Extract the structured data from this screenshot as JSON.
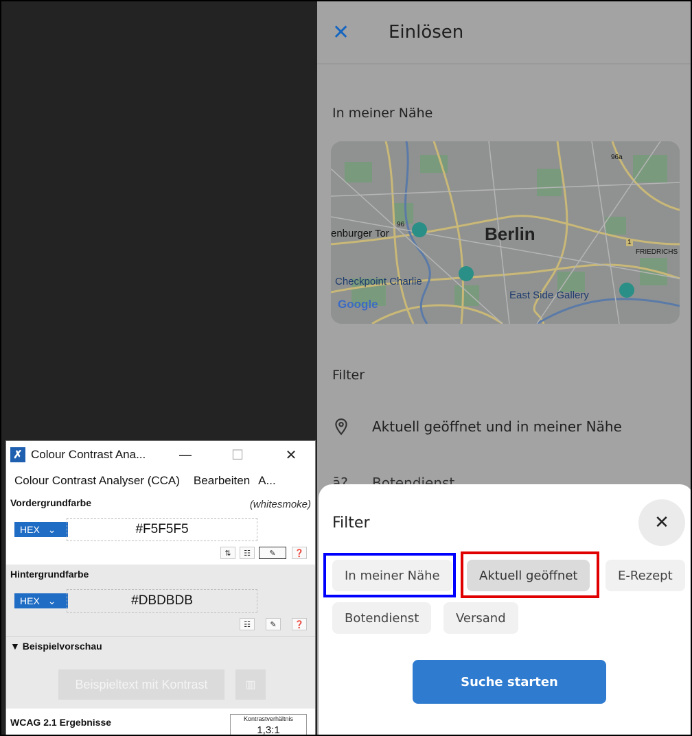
{
  "app": {
    "close_icon": "close-icon",
    "title": "Einlösen",
    "nearby_label": "In meiner Nähe",
    "map": {
      "city": "Berlin",
      "labels": [
        "enburger Tor",
        "Checkpoint Charlie",
        "East Side Gallery",
        "FRIEDRICHS",
        "96",
        "96a",
        "1"
      ],
      "attribution": "Google"
    },
    "filter_label": "Filter",
    "filter_row_text": "Aktuell geöffnet und in meiner Nähe",
    "partial_row_text": "Botendienst"
  },
  "sheet": {
    "title": "Filter",
    "close_icon": "close-icon",
    "chips": [
      "In meiner Nähe",
      "Aktuell geöffnet",
      "E-Rezept",
      "Botendienst",
      "Versand"
    ],
    "selected_chip": "Aktuell geöffnet",
    "search_button": "Suche starten"
  },
  "cca": {
    "window_title": "Colour Contrast Ana...",
    "minimize": "—",
    "maximize": "☐",
    "close": "✕",
    "menu": [
      "Colour Contrast Analyser (CCA)",
      "Bearbeiten",
      "A..."
    ],
    "foreground": {
      "label": "Vordergrundfarbe",
      "name": "(whitesmoke)",
      "format": "HEX",
      "value": "#F5F5F5"
    },
    "background": {
      "label": "Hintergrundfarbe",
      "format": "HEX",
      "value": "#DBDBDB"
    },
    "preview": {
      "label": "▼ Beispielvorschau",
      "sample_text": "Beispieltext mit Kontrast"
    },
    "results": {
      "label": "WCAG 2.1 Ergebnisse",
      "ratio_label": "Kontrastverhältnis",
      "ratio_value": "1,3:1"
    }
  },
  "colors": {
    "accent": "#2E7BCF",
    "highlight_blue": "#0000FF",
    "highlight_red": "#E00000",
    "foreground_sample": "#F5F5F5",
    "background_sample": "#DBDBDB"
  }
}
